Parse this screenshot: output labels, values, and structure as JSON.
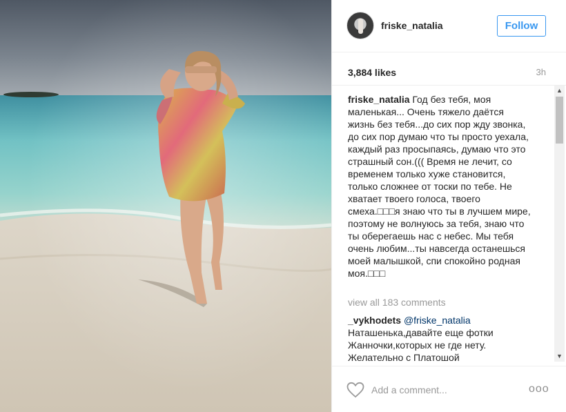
{
  "post": {
    "username": "friske_natalia",
    "follow_label": "Follow",
    "likes": "3,884 likes",
    "time": "3h"
  },
  "caption": {
    "username": "friske_natalia",
    "text": "Год без тебя, моя маленькая... Очень тяжело даётся жизнь без тебя...до сих пор жду звонка, до сих пор думаю что ты просто уехала, каждый раз просыпаясь, думаю что это страшный сон.((( Время не лечит, со временем только хуже становится, только сложнее от тоски по тебе. Не хватает твоего голоса, твоего смеха.□□□я знаю что ты в лучшем мире, поэтому не волнуюсь за тебя, знаю что ты оберегаешь нас с небес. Мы тебя очень любим...ты навсегда останешься моей малышкой, спи спокойно родная моя.□□□"
  },
  "view_all": "view all 183 comments",
  "comment": {
    "username": "_vykhodets",
    "mention": "@friske_natalia",
    "text": "Наташенька,давайте еще фотки Жанночки,которых не где нету. Желательно с Платошой"
  },
  "footer": {
    "add_comment_placeholder": "Add a comment...",
    "more_label": "ooo"
  },
  "icons": {
    "heart": "heart-icon",
    "more": "more-options-icon",
    "scroll_up": "scroll-up-arrow-icon",
    "scroll_down": "scroll-down-arrow-icon"
  },
  "colors": {
    "accent": "#3897f0",
    "border": "#efefef",
    "muted": "#999999",
    "text": "#262626"
  }
}
